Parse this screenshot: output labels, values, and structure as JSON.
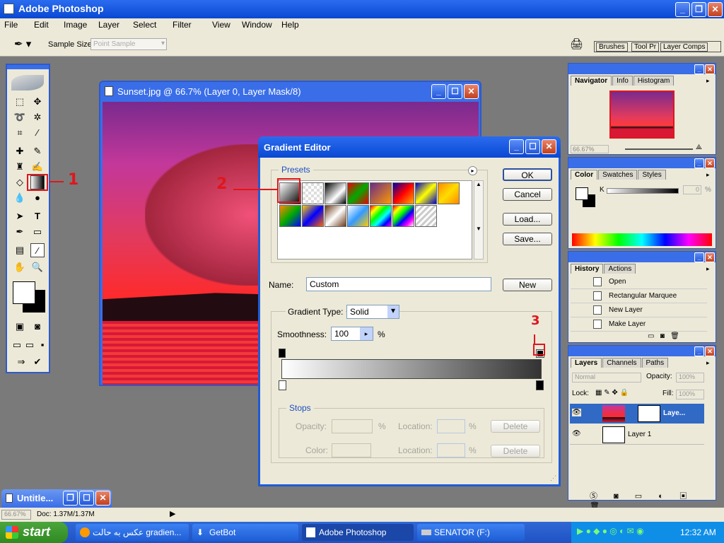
{
  "app": {
    "title": "Adobe Photoshop"
  },
  "menu": [
    "File",
    "Edit",
    "Image",
    "Layer",
    "Select",
    "Filter",
    "View",
    "Window",
    "Help"
  ],
  "options": {
    "sample_label": "Sample Size:",
    "sample_value": "Point Sample"
  },
  "palette_well": {
    "tabs": [
      "Brushes",
      "Tool Pr",
      "Layer Comps"
    ]
  },
  "doc": {
    "title": "Sunset.jpg @ 66.7% (Layer 0, Layer Mask/8)"
  },
  "gradient_editor": {
    "title": "Gradient Editor",
    "presets_label": "Presets",
    "buttons": {
      "ok": "OK",
      "cancel": "Cancel",
      "load": "Load...",
      "save": "Save...",
      "new": "New"
    },
    "name_label": "Name:",
    "name_value": "Custom",
    "type_label": "Gradient Type:",
    "type_value": "Solid",
    "smooth_label": "Smoothness:",
    "smooth_value": "100",
    "smooth_unit": "%",
    "stops": {
      "label": "Stops",
      "opacity_label": "Opacity:",
      "pct": "%",
      "location_label": "Location:",
      "color_label": "Color:",
      "delete": "Delete"
    }
  },
  "annotations": {
    "one": "1",
    "two": "2",
    "three": "3"
  },
  "navigator": {
    "tabs": [
      "Navigator",
      "Info",
      "Histogram"
    ],
    "zoom": "66.67%"
  },
  "color": {
    "tabs": [
      "Color",
      "Swatches",
      "Styles"
    ],
    "k_label": "K",
    "k_value": "0",
    "pct": "%"
  },
  "history": {
    "tabs": [
      "History",
      "Actions"
    ],
    "items": [
      "Open",
      "Rectangular Marquee",
      "New Layer",
      "Make Layer"
    ]
  },
  "layers": {
    "tabs": [
      "Layers",
      "Channels",
      "Paths"
    ],
    "blend": "Normal",
    "opacity_label": "Opacity:",
    "opacity": "100%",
    "lock_label": "Lock:",
    "fill_label": "Fill:",
    "fill": "100%",
    "items": [
      "Laye...",
      "Layer 1"
    ]
  },
  "minimized": {
    "title": "Untitle..."
  },
  "status": {
    "zoom": "66.67%",
    "doc": "Doc: 1.37M/1.37M"
  },
  "taskbar": {
    "start": "start",
    "items": [
      "عکس به حالت gradien...",
      "GetBot",
      "Adobe Photoshop",
      "SENATOR (F:)"
    ],
    "clock": "12:32 AM"
  },
  "colors": {
    "accent": "#2d5aca",
    "annotation": "#e0161c",
    "taskbar": "#245edb",
    "start": "#3c9a32"
  }
}
